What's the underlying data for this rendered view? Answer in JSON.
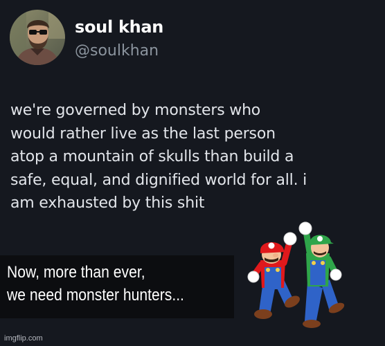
{
  "profile": {
    "name": "soul khan",
    "handle": "@soulkhan",
    "avatar_icon": "profile-photo"
  },
  "tweet": {
    "lines": [
      "we're governed by monsters who",
      "would rather live as the last person",
      "atop a mountain of skulls than build a",
      "safe, equal, and dignified world for all. i",
      "am exhausted by this shit"
    ]
  },
  "caption": {
    "lines": [
      "Now, more than ever,",
      "we need monster hunters..."
    ]
  },
  "artwork": {
    "icon": "mario-luigi-jumping",
    "colors": {
      "mario_red": "#e0191c",
      "luigi_green": "#2fa54a",
      "overalls_blue": "#2f63c8"
    }
  },
  "watermark": "imgflip.com",
  "colors": {
    "background": "#15181f",
    "text": "#e2e5ea",
    "secondary_text": "#8b949e"
  }
}
